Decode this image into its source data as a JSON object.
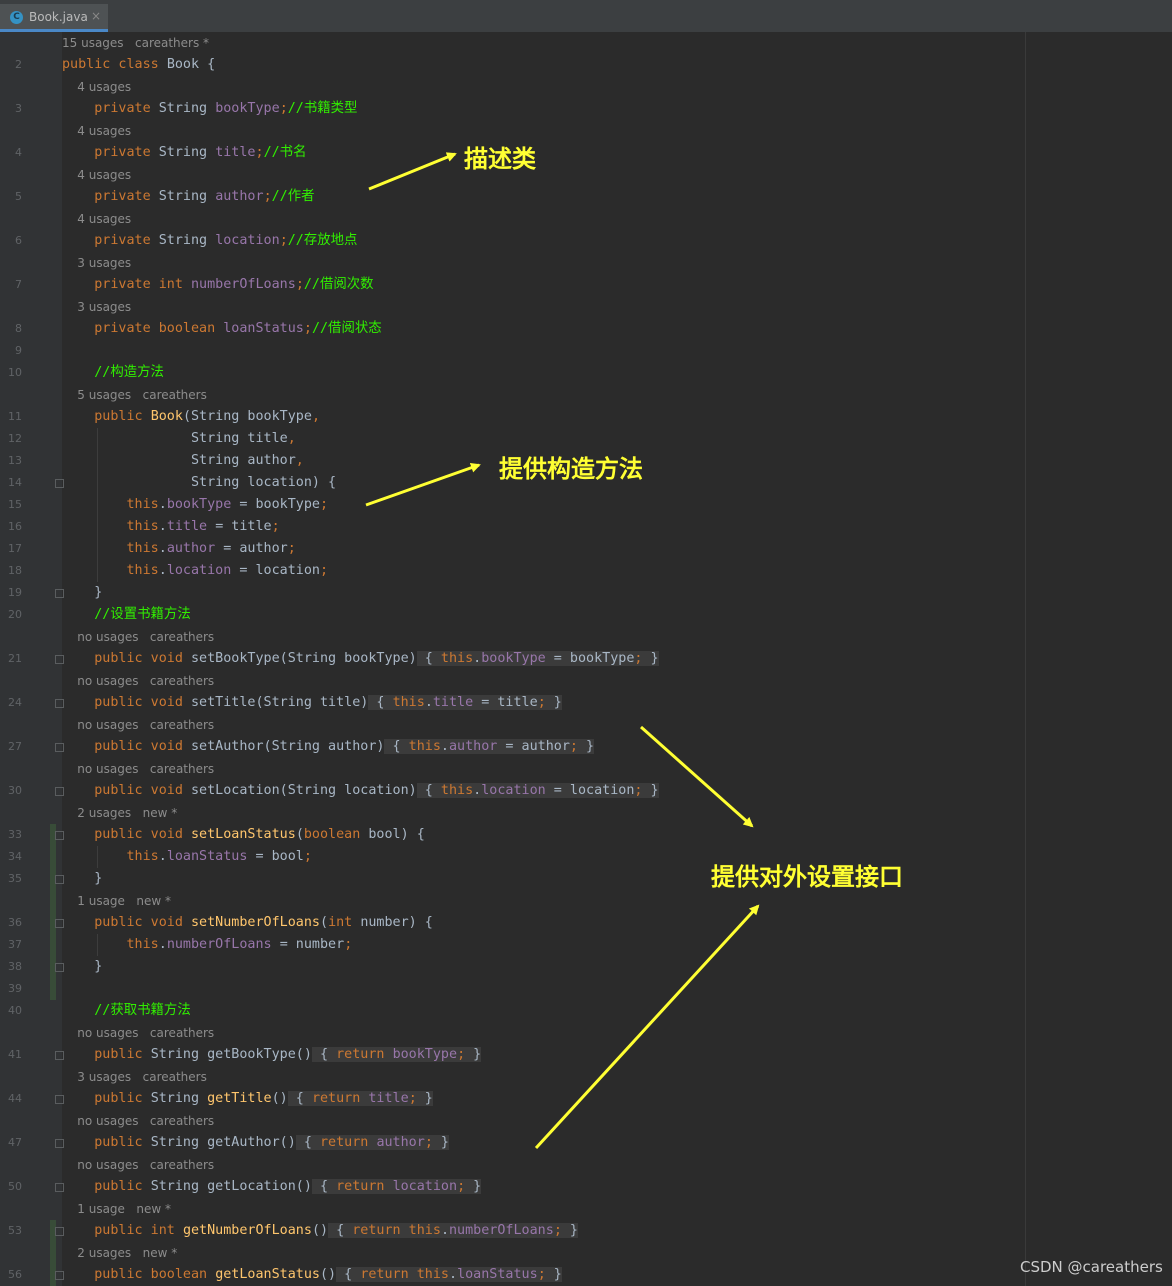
{
  "tab": {
    "icon": "C",
    "label": "Book.java",
    "close": "×"
  },
  "code": {
    "l1h": "15 usages   careathers *",
    "l2": [
      "public",
      "class",
      "Book {"
    ],
    "h4usages": "4 usages",
    "h3usages": "3 usages",
    "h5usages": "5 usages   careathers",
    "nousages": "no usages   careathers",
    "h2new": "2 usages   new *",
    "h1new": "1 usage   new *",
    "h3care": "3 usages   careathers",
    "c_bookType": "//书籍类型",
    "c_title": "//书名",
    "c_author": "//作者",
    "c_location": "//存放地点",
    "c_loans": "//借阅次数",
    "c_status": "//借阅状态",
    "c_ctor": "//构造方法",
    "c_set": "//设置书籍方法",
    "c_get": "//获取书籍方法"
  },
  "annotations": {
    "a1": "描述类",
    "a2": "提供构造方法",
    "a3": "提供对外设置接口"
  },
  "watermark": "CSDN @careathers"
}
